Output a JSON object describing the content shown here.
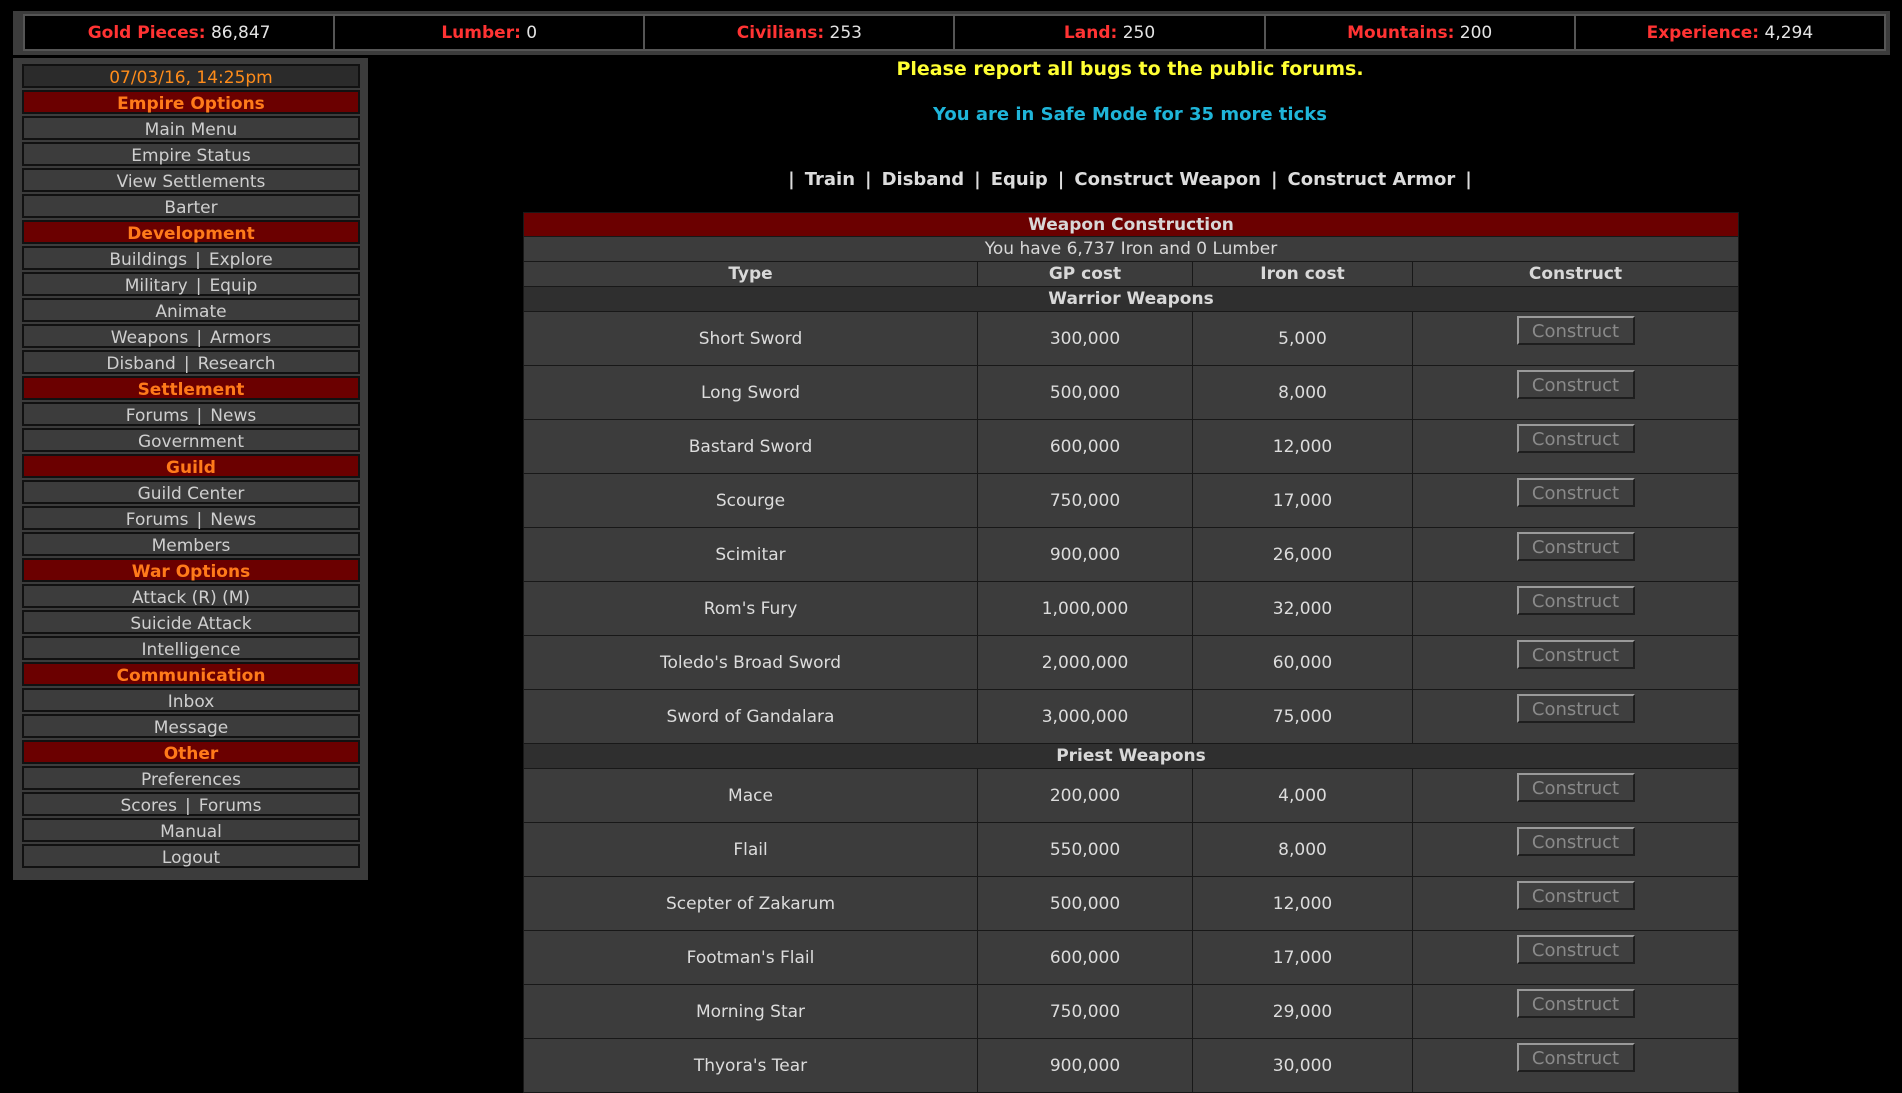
{
  "stats": [
    {
      "label": "Gold Pieces:",
      "value": "86,847"
    },
    {
      "label": "Lumber:",
      "value": "0"
    },
    {
      "label": "Civilians:",
      "value": "253"
    },
    {
      "label": "Land:",
      "value": "250"
    },
    {
      "label": "Mountains:",
      "value": "200"
    },
    {
      "label": "Experience:",
      "value": "4,294"
    }
  ],
  "menu": {
    "date": "07/03/16, 14:25pm",
    "empire_options": "Empire Options",
    "main_menu": "Main Menu",
    "empire_status": "Empire Status",
    "view_settlements": "View Settlements",
    "barter": "Barter",
    "development": "Development",
    "buildings": "Buildings",
    "explore": "Explore",
    "military": "Military",
    "equip": "Equip",
    "animate": "Animate",
    "weapons": "Weapons",
    "armors": "Armors",
    "disband": "Disband",
    "research": "Research",
    "settlement": "Settlement",
    "settlement_forums": "Forums",
    "settlement_news": "News",
    "government": "Government",
    "guild": "Guild",
    "guild_center": "Guild Center",
    "guild_forums": "Forums",
    "guild_news": "News",
    "members": "Members",
    "war_options": "War Options",
    "attack": "Attack (R) (M)",
    "suicide_attack": "Suicide Attack",
    "intelligence": "Intelligence",
    "communication": "Communication",
    "inbox": "Inbox",
    "message": "Message",
    "other": "Other",
    "preferences": "Preferences",
    "scores": "Scores",
    "other_forums": "Forums",
    "manual": "Manual",
    "logout": "Logout",
    "separator": "|"
  },
  "notices": {
    "bugs": "Please report all bugs to the public forums.",
    "safe_mode": "You are in Safe Mode for 35 more ticks"
  },
  "nav": {
    "bar": "|",
    "train": "Train",
    "disband": "Disband",
    "equip": "Equip",
    "construct_weapon": "Construct Weapon",
    "construct_armor": "Construct Armor"
  },
  "table": {
    "title": "Weapon Construction",
    "have": "You have 6,737 Iron and 0 Lumber",
    "columns": [
      "Type",
      "GP cost",
      "Iron cost",
      "Construct"
    ],
    "button_label": "Construct",
    "groups": [
      {
        "name": "Warrior Weapons",
        "items": [
          {
            "type": "Short Sword",
            "gp": "300,000",
            "iron": "5,000"
          },
          {
            "type": "Long Sword",
            "gp": "500,000",
            "iron": "8,000"
          },
          {
            "type": "Bastard Sword",
            "gp": "600,000",
            "iron": "12,000"
          },
          {
            "type": "Scourge",
            "gp": "750,000",
            "iron": "17,000"
          },
          {
            "type": "Scimitar",
            "gp": "900,000",
            "iron": "26,000"
          },
          {
            "type": "Rom's Fury",
            "gp": "1,000,000",
            "iron": "32,000"
          },
          {
            "type": "Toledo's Broad Sword",
            "gp": "2,000,000",
            "iron": "60,000"
          },
          {
            "type": "Sword of Gandalara",
            "gp": "3,000,000",
            "iron": "75,000"
          }
        ]
      },
      {
        "name": "Priest Weapons",
        "items": [
          {
            "type": "Mace",
            "gp": "200,000",
            "iron": "4,000"
          },
          {
            "type": "Flail",
            "gp": "550,000",
            "iron": "8,000"
          },
          {
            "type": "Scepter of Zakarum",
            "gp": "500,000",
            "iron": "12,000"
          },
          {
            "type": "Footman's Flail",
            "gp": "600,000",
            "iron": "17,000"
          },
          {
            "type": "Morning Star",
            "gp": "750,000",
            "iron": "29,000"
          },
          {
            "type": "Thyora's Tear",
            "gp": "900,000",
            "iron": "30,000"
          }
        ]
      }
    ]
  },
  "colors": {
    "stat_label": "#ff3333",
    "menu_header_bg": "#6b0000",
    "menu_header_text": "#ff7a1a",
    "notice_yellow": "#ffff33",
    "notice_cyan": "#1fb5d9"
  }
}
